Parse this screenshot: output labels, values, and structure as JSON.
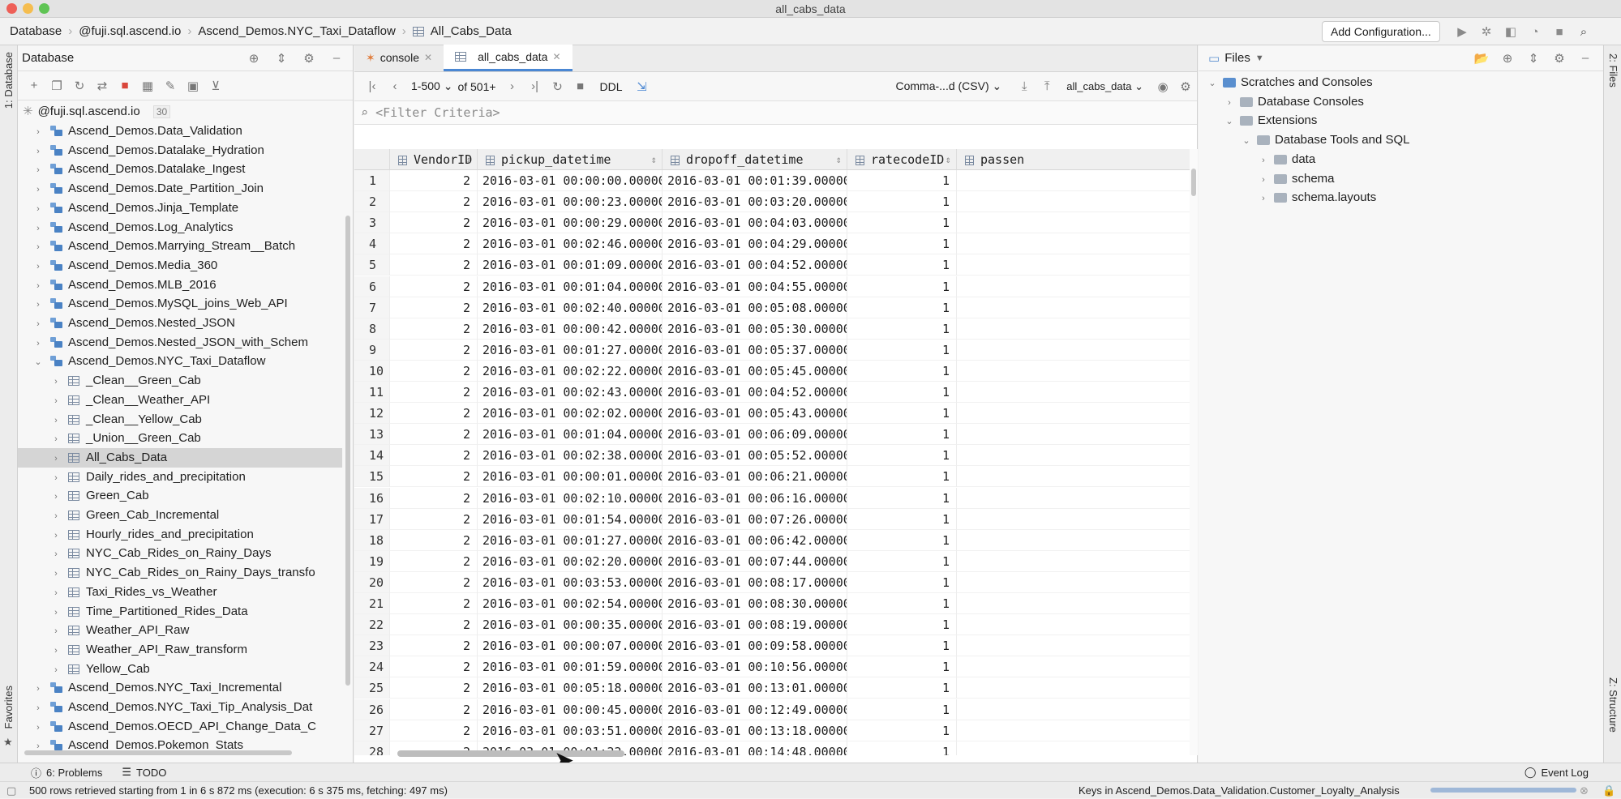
{
  "window": {
    "title": "all_cabs_data"
  },
  "breadcrumbs": [
    "Database",
    "@fuji.sql.ascend.io",
    "Ascend_Demos.NYC_Taxi_Dataflow",
    "All_Cabs_Data"
  ],
  "toolbar": {
    "add_config_label": "Add Configuration..."
  },
  "left_strip": {
    "database_label": "1: Database",
    "favorites_label": "Favorites"
  },
  "right_strip": {
    "files_label": "2: Files",
    "structure_label": "Z: Structure"
  },
  "db_panel": {
    "title": "Database",
    "root_label": "@fuji.sql.ascend.io",
    "root_badge": "30",
    "items": [
      {
        "label": "Ascend_Demos.Data_Validation",
        "kind": "schema",
        "level": 1,
        "chev": "›"
      },
      {
        "label": "Ascend_Demos.Datalake_Hydration",
        "kind": "schema",
        "level": 1,
        "chev": "›"
      },
      {
        "label": "Ascend_Demos.Datalake_Ingest",
        "kind": "schema",
        "level": 1,
        "chev": "›"
      },
      {
        "label": "Ascend_Demos.Date_Partition_Join",
        "kind": "schema",
        "level": 1,
        "chev": "›"
      },
      {
        "label": "Ascend_Demos.Jinja_Template",
        "kind": "schema",
        "level": 1,
        "chev": "›"
      },
      {
        "label": "Ascend_Demos.Log_Analytics",
        "kind": "schema",
        "level": 1,
        "chev": "›"
      },
      {
        "label": "Ascend_Demos.Marrying_Stream__Batch",
        "kind": "schema",
        "level": 1,
        "chev": "›"
      },
      {
        "label": "Ascend_Demos.Media_360",
        "kind": "schema",
        "level": 1,
        "chev": "›"
      },
      {
        "label": "Ascend_Demos.MLB_2016",
        "kind": "schema",
        "level": 1,
        "chev": "›"
      },
      {
        "label": "Ascend_Demos.MySQL_joins_Web_API",
        "kind": "schema",
        "level": 1,
        "chev": "›"
      },
      {
        "label": "Ascend_Demos.Nested_JSON",
        "kind": "schema",
        "level": 1,
        "chev": "›"
      },
      {
        "label": "Ascend_Demos.Nested_JSON_with_Schem",
        "kind": "schema",
        "level": 1,
        "chev": "›"
      },
      {
        "label": "Ascend_Demos.NYC_Taxi_Dataflow",
        "kind": "schema",
        "level": 1,
        "chev": "⌄"
      },
      {
        "label": "_Clean__Green_Cab",
        "kind": "table",
        "level": 2,
        "chev": "›"
      },
      {
        "label": "_Clean__Weather_API",
        "kind": "table",
        "level": 2,
        "chev": "›"
      },
      {
        "label": "_Clean__Yellow_Cab",
        "kind": "table",
        "level": 2,
        "chev": "›"
      },
      {
        "label": "_Union__Green_Cab",
        "kind": "table",
        "level": 2,
        "chev": "›"
      },
      {
        "label": "All_Cabs_Data",
        "kind": "table",
        "level": 2,
        "chev": "›",
        "selected": true
      },
      {
        "label": "Daily_rides_and_precipitation",
        "kind": "table",
        "level": 2,
        "chev": "›"
      },
      {
        "label": "Green_Cab",
        "kind": "table",
        "level": 2,
        "chev": "›"
      },
      {
        "label": "Green_Cab_Incremental",
        "kind": "table",
        "level": 2,
        "chev": "›"
      },
      {
        "label": "Hourly_rides_and_precipitation",
        "kind": "table",
        "level": 2,
        "chev": "›"
      },
      {
        "label": "NYC_Cab_Rides_on_Rainy_Days",
        "kind": "table",
        "level": 2,
        "chev": "›"
      },
      {
        "label": "NYC_Cab_Rides_on_Rainy_Days_transfo",
        "kind": "table",
        "level": 2,
        "chev": "›"
      },
      {
        "label": "Taxi_Rides_vs_Weather",
        "kind": "table",
        "level": 2,
        "chev": "›"
      },
      {
        "label": "Time_Partitioned_Rides_Data",
        "kind": "table",
        "level": 2,
        "chev": "›"
      },
      {
        "label": "Weather_API_Raw",
        "kind": "table",
        "level": 2,
        "chev": "›"
      },
      {
        "label": "Weather_API_Raw_transform",
        "kind": "table",
        "level": 2,
        "chev": "›"
      },
      {
        "label": "Yellow_Cab",
        "kind": "table",
        "level": 2,
        "chev": "›"
      },
      {
        "label": "Ascend_Demos.NYC_Taxi_Incremental",
        "kind": "schema",
        "level": 1,
        "chev": "›"
      },
      {
        "label": "Ascend_Demos.NYC_Taxi_Tip_Analysis_Dat",
        "kind": "schema",
        "level": 1,
        "chev": "›"
      },
      {
        "label": "Ascend_Demos.OECD_API_Change_Data_C",
        "kind": "schema",
        "level": 1,
        "chev": "›"
      },
      {
        "label": "Ascend_Demos.Pokemon_Stats",
        "kind": "schema",
        "level": 1,
        "chev": "›"
      }
    ]
  },
  "editor": {
    "tabs": [
      {
        "label": "console"
      },
      {
        "label": "all_cabs_data"
      }
    ],
    "pager": {
      "range": "1-500",
      "of": "of 501+"
    },
    "ddl_label": "DDL",
    "format_label": "Comma-...d (CSV)",
    "table_selector": "all_cabs_data",
    "filter_placeholder": "<Filter Criteria>",
    "columns": [
      "VendorID",
      "pickup_datetime",
      "dropoff_datetime",
      "ratecodeID",
      "passen"
    ],
    "rows": [
      [
        "1",
        "2",
        "2016-03-01 00:00:00.000000000",
        "2016-03-01 00:01:39.000000000",
        "1"
      ],
      [
        "2",
        "2",
        "2016-03-01 00:00:23.000000000",
        "2016-03-01 00:03:20.000000000",
        "1"
      ],
      [
        "3",
        "2",
        "2016-03-01 00:00:29.000000000",
        "2016-03-01 00:04:03.000000000",
        "1"
      ],
      [
        "4",
        "2",
        "2016-03-01 00:02:46.000000000",
        "2016-03-01 00:04:29.000000000",
        "1"
      ],
      [
        "5",
        "2",
        "2016-03-01 00:01:09.000000000",
        "2016-03-01 00:04:52.000000000",
        "1"
      ],
      [
        "6",
        "2",
        "2016-03-01 00:01:04.000000000",
        "2016-03-01 00:04:55.000000000",
        "1"
      ],
      [
        "7",
        "2",
        "2016-03-01 00:02:40.000000000",
        "2016-03-01 00:05:08.000000000",
        "1"
      ],
      [
        "8",
        "2",
        "2016-03-01 00:00:42.000000000",
        "2016-03-01 00:05:30.000000000",
        "1"
      ],
      [
        "9",
        "2",
        "2016-03-01 00:01:27.000000000",
        "2016-03-01 00:05:37.000000000",
        "1"
      ],
      [
        "10",
        "2",
        "2016-03-01 00:02:22.000000000",
        "2016-03-01 00:05:45.000000000",
        "1"
      ],
      [
        "11",
        "2",
        "2016-03-01 00:02:43.000000000",
        "2016-03-01 00:04:52.000000000",
        "1"
      ],
      [
        "12",
        "2",
        "2016-03-01 00:02:02.000000000",
        "2016-03-01 00:05:43.000000000",
        "1"
      ],
      [
        "13",
        "2",
        "2016-03-01 00:01:04.000000000",
        "2016-03-01 00:06:09.000000000",
        "1"
      ],
      [
        "14",
        "2",
        "2016-03-01 00:02:38.000000000",
        "2016-03-01 00:05:52.000000000",
        "1"
      ],
      [
        "15",
        "2",
        "2016-03-01 00:00:01.000000000",
        "2016-03-01 00:06:21.000000000",
        "1"
      ],
      [
        "16",
        "2",
        "2016-03-01 00:02:10.000000000",
        "2016-03-01 00:06:16.000000000",
        "1"
      ],
      [
        "17",
        "2",
        "2016-03-01 00:01:54.000000000",
        "2016-03-01 00:07:26.000000000",
        "1"
      ],
      [
        "18",
        "2",
        "2016-03-01 00:01:27.000000000",
        "2016-03-01 00:06:42.000000000",
        "1"
      ],
      [
        "19",
        "2",
        "2016-03-01 00:02:20.000000000",
        "2016-03-01 00:07:44.000000000",
        "1"
      ],
      [
        "20",
        "2",
        "2016-03-01 00:03:53.000000000",
        "2016-03-01 00:08:17.000000000",
        "1"
      ],
      [
        "21",
        "2",
        "2016-03-01 00:02:54.000000000",
        "2016-03-01 00:08:30.000000000",
        "1"
      ],
      [
        "22",
        "2",
        "2016-03-01 00:00:35.000000000",
        "2016-03-01 00:08:19.000000000",
        "1"
      ],
      [
        "23",
        "2",
        "2016-03-01 00:00:07.000000000",
        "2016-03-01 00:09:58.000000000",
        "1"
      ],
      [
        "24",
        "2",
        "2016-03-01 00:01:59.000000000",
        "2016-03-01 00:10:56.000000000",
        "1"
      ],
      [
        "25",
        "2",
        "2016-03-01 00:05:18.000000000",
        "2016-03-01 00:13:01.000000000",
        "1"
      ],
      [
        "26",
        "2",
        "2016-03-01 00:00:45.000000000",
        "2016-03-01 00:12:49.000000000",
        "1"
      ],
      [
        "27",
        "2",
        "2016-03-01 00:03:51.000000000",
        "2016-03-01 00:13:18.000000000",
        "1"
      ],
      [
        "28",
        "2",
        "2016-03-01 00:01:22.000000000",
        "2016-03-01 00:14:48.000000000",
        "1"
      ]
    ]
  },
  "files_panel": {
    "title": "Files",
    "items": [
      {
        "label": "Scratches and Consoles",
        "level": 0,
        "chev": "⌄"
      },
      {
        "label": "Database Consoles",
        "level": 1,
        "chev": "›"
      },
      {
        "label": "Extensions",
        "level": 1,
        "chev": "⌄"
      },
      {
        "label": "Database Tools and SQL",
        "level": 2,
        "chev": "⌄"
      },
      {
        "label": "data",
        "level": 3,
        "chev": "›"
      },
      {
        "label": "schema",
        "level": 3,
        "chev": "›"
      },
      {
        "label": "schema.layouts",
        "level": 3,
        "chev": "›"
      }
    ]
  },
  "bottom_bar": {
    "problems_label": "6: Problems",
    "todo_label": "TODO",
    "event_log_label": "Event Log"
  },
  "status": {
    "message": "500 rows retrieved starting from 1 in 6 s 872 ms (execution: 6 s 375 ms, fetching: 497 ms)",
    "right": "Keys in Ascend_Demos.Data_Validation.Customer_Loyalty_Analysis"
  },
  "colors": {
    "accent": "#4a87d3",
    "selection": "#d5d5d5",
    "stop_red": "#d9463b"
  }
}
